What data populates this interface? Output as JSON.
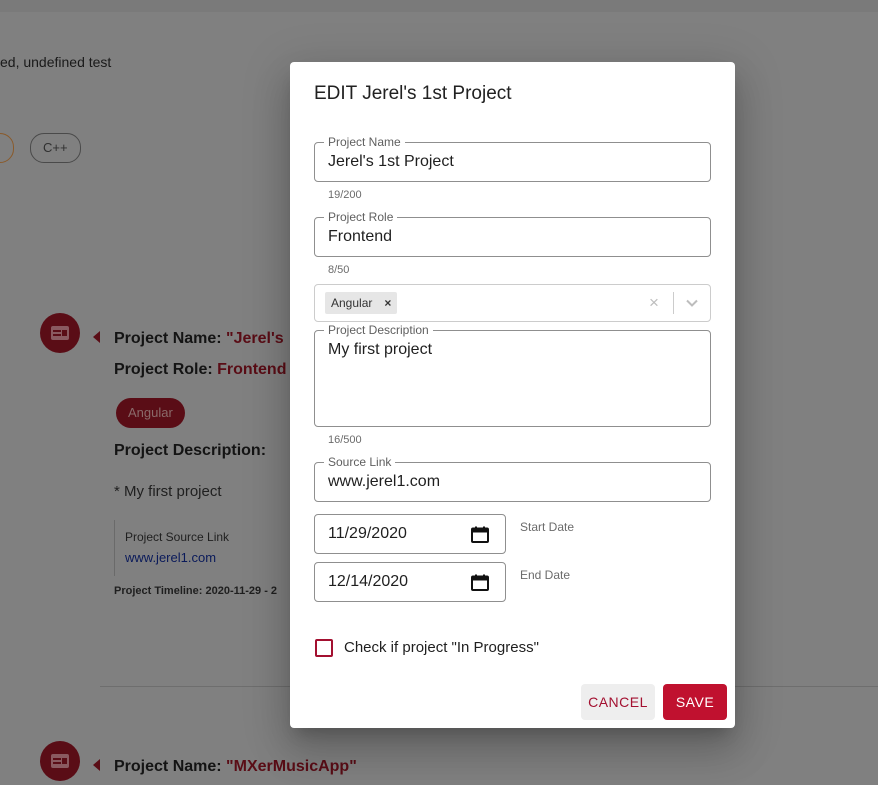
{
  "background": {
    "top_text": "ed, undefined test",
    "chip": "C++",
    "project1": {
      "name_label": "Project Name:",
      "name_value": "\"Jerel's",
      "role_label": "Project Role:",
      "role_value": "Frontend",
      "tag": "Angular",
      "desc_label": "Project Description:",
      "desc_item": "* My first project",
      "source_title": "Project Source Link",
      "source_link": "www.jerel1.com",
      "timeline": "Project Timeline:   2020-11-29 - 2"
    },
    "project2": {
      "name_label": "Project Name:",
      "name_value": "\"MXerMusicApp\""
    }
  },
  "dialog": {
    "title": "EDIT Jerel's 1st Project",
    "project_name": {
      "label": "Project Name",
      "value": "Jerel's 1st Project",
      "counter": "19/200"
    },
    "project_role": {
      "label": "Project Role",
      "value": "Frontend",
      "counter": "8/50"
    },
    "technologies": {
      "selected": [
        "Angular"
      ],
      "remove_glyph": "×",
      "clear_glyph": "×"
    },
    "project_description": {
      "label": "Project Description",
      "value": "My first project",
      "counter": "16/500"
    },
    "source_link": {
      "label": "Source Link",
      "value": "www.jerel1.com"
    },
    "start_date": {
      "value": "11/29/2020",
      "caption": "Start Date"
    },
    "end_date": {
      "value": "12/14/2020",
      "caption": "End Date"
    },
    "in_progress": {
      "label": "Check if project \"In Progress\"",
      "checked": false
    },
    "cancel_label": "CANCEL",
    "save_label": "SAVE"
  },
  "colors": {
    "accent": "#c0112f",
    "accent_text": "#a31030",
    "backdrop": "#808080",
    "dark_accent": "#5a0d16"
  },
  "icons": {
    "avatar": "project-card-icon",
    "calendar": "calendar-icon",
    "dropdown": "chevron-down-icon"
  }
}
